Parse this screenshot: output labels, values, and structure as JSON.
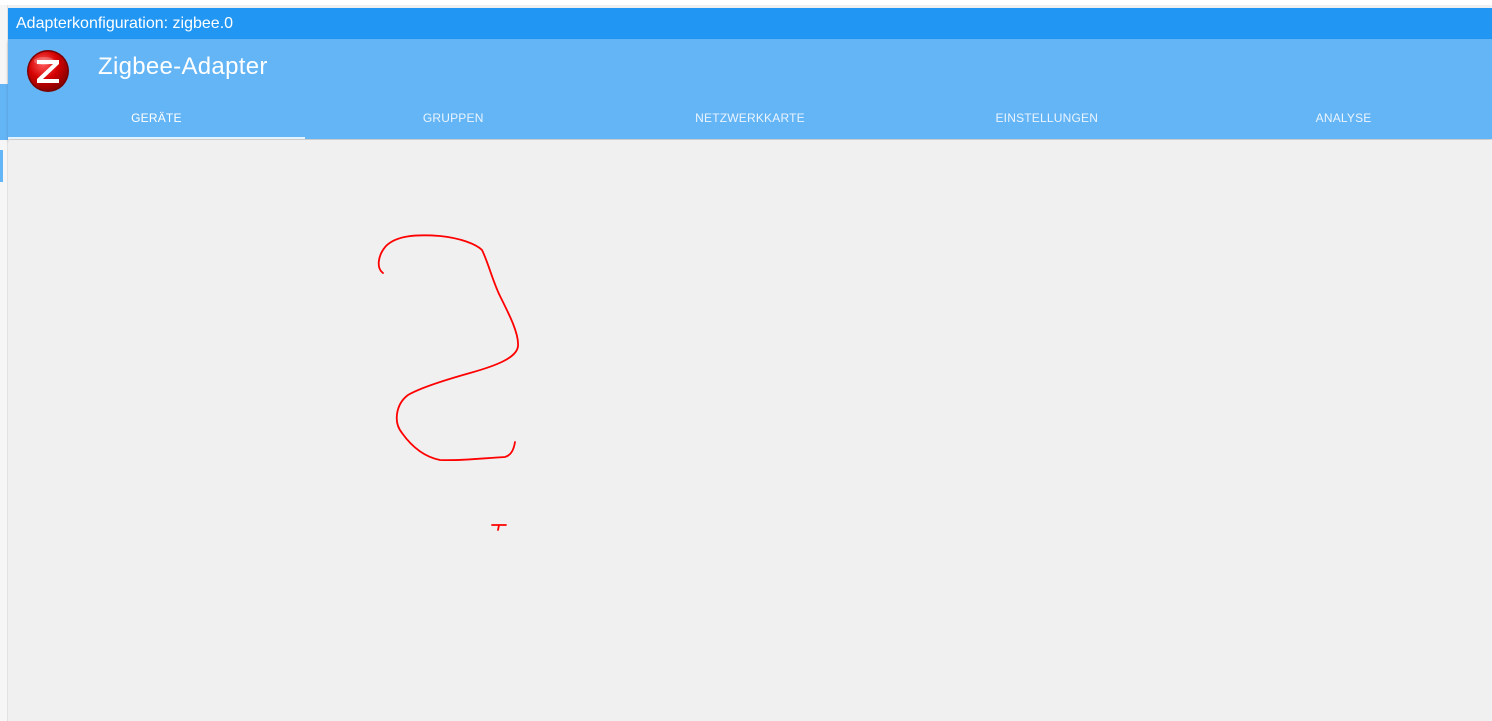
{
  "window": {
    "title": "Adapterkonfiguration: zigbee.0"
  },
  "header": {
    "app_title": "Zigbee-Adapter",
    "logo_icon": "zigbee-logo-icon",
    "colors": {
      "titlebar": "#2196f3",
      "header": "#64b5f6",
      "logo_red": "#e00000"
    }
  },
  "tabs": [
    {
      "label": "GERÄTE",
      "active": true
    },
    {
      "label": "GRUPPEN",
      "active": false
    },
    {
      "label": "NETZWERKKARTE",
      "active": false
    },
    {
      "label": "EINSTELLUNGEN",
      "active": false
    },
    {
      "label": "ANALYSE",
      "active": false
    }
  ],
  "annotation": {
    "color": "#ff0000"
  }
}
